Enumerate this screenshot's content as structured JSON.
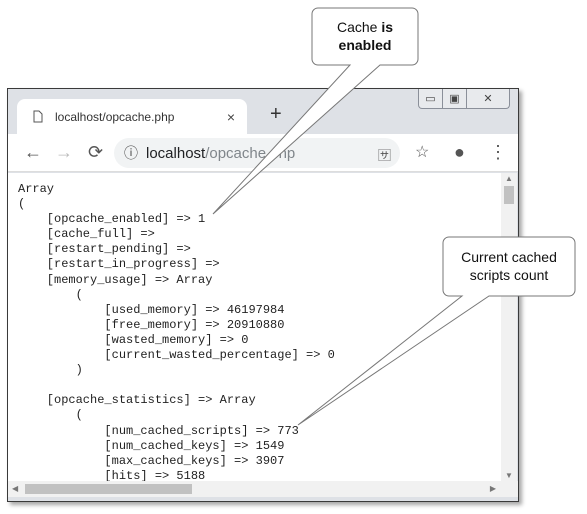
{
  "browser": {
    "tab_title": "localhost/opcache.php",
    "tab_close": "×",
    "new_tab": "+",
    "url_host": "localhost",
    "url_path": "/opcache.php",
    "window_controls": {
      "minimize": "▭",
      "maximize": "▣",
      "close": "✕"
    }
  },
  "icons": {
    "back": "←",
    "forward": "→",
    "reload": "⟳",
    "info": "ⓘ",
    "translate": "🈂",
    "star": "☆",
    "profile": "●",
    "menu": "⋮"
  },
  "content": {
    "lines": [
      "Array",
      "(",
      "    [opcache_enabled] => 1",
      "    [cache_full] =>",
      "    [restart_pending] =>",
      "    [restart_in_progress] =>",
      "    [memory_usage] => Array",
      "        (",
      "            [used_memory] => 46197984",
      "            [free_memory] => 20910880",
      "            [wasted_memory] => 0",
      "            [current_wasted_percentage] => 0",
      "        )",
      "",
      "    [opcache_statistics] => Array",
      "        (",
      "            [num_cached_scripts] => 773",
      "            [num_cached_keys] => 1549",
      "            [max_cached_keys] => 3907",
      "            [hits] => 5188"
    ]
  },
  "callouts": {
    "cache": {
      "line1": "Cache ",
      "line1_bold": "is",
      "line2_bold": "enabled"
    },
    "scripts": {
      "line1": "Current cached",
      "line2": "scripts count"
    }
  }
}
